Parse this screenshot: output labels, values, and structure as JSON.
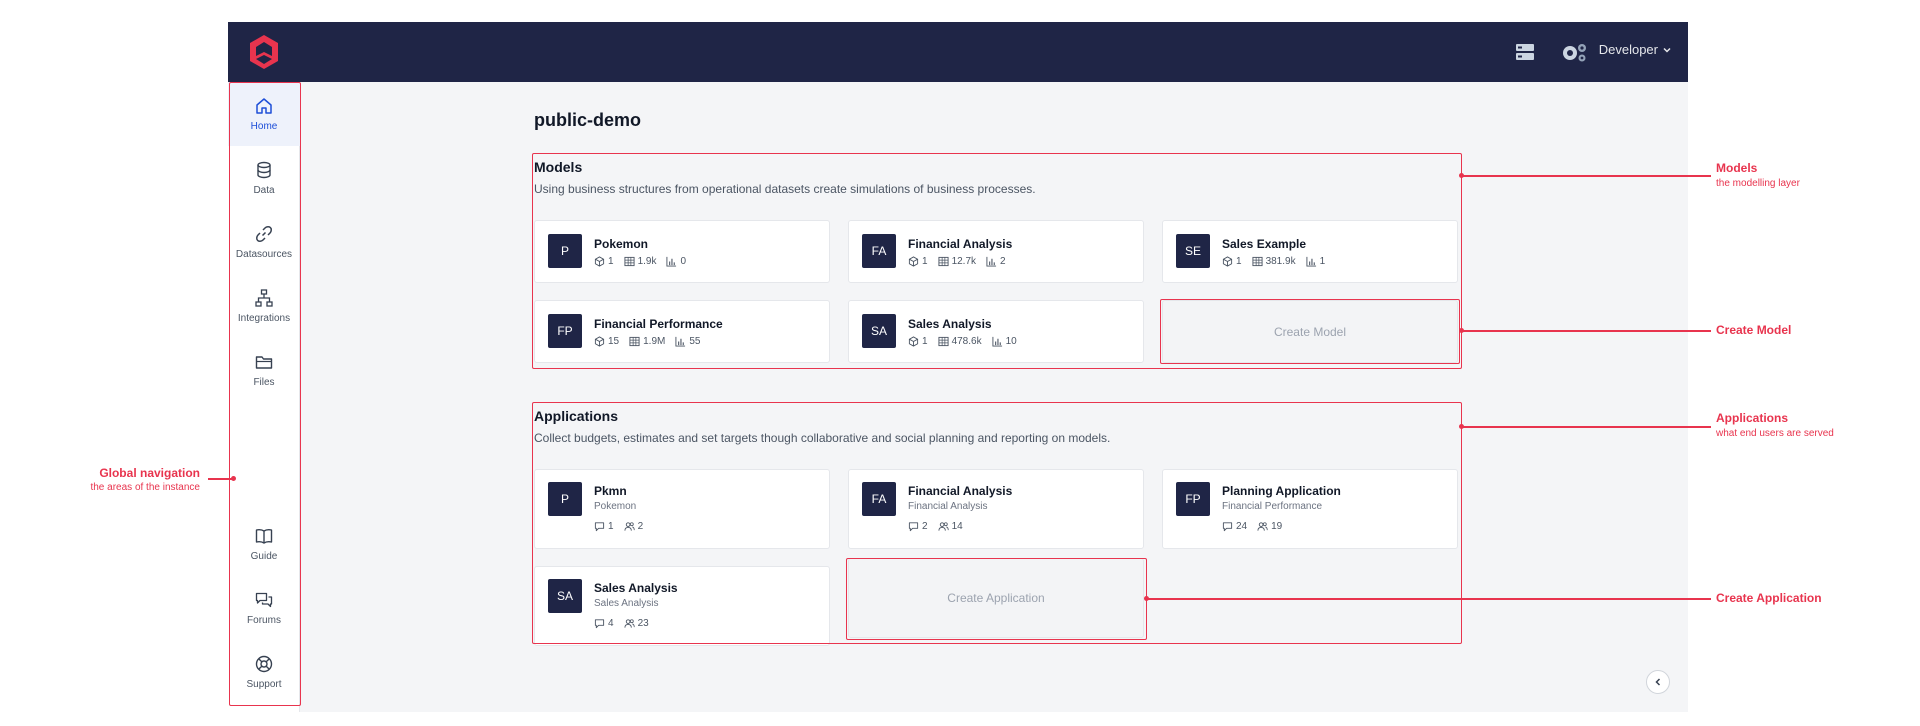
{
  "topbar": {
    "user_label": "Developer"
  },
  "sidebar": {
    "items": [
      {
        "label": "Home",
        "icon": "home-icon"
      },
      {
        "label": "Data",
        "icon": "database-icon"
      },
      {
        "label": "Datasources",
        "icon": "link-icon"
      },
      {
        "label": "Integrations",
        "icon": "network-icon"
      },
      {
        "label": "Files",
        "icon": "folder-icon"
      },
      {
        "label": "Guide",
        "icon": "book-icon"
      },
      {
        "label": "Forums",
        "icon": "chat-icon"
      },
      {
        "label": "Support",
        "icon": "lifebuoy-icon"
      }
    ]
  },
  "main": {
    "title": "public-demo",
    "models": {
      "title": "Models",
      "description": "Using business structures from operational datasets create simulations of business processes.",
      "cards": [
        {
          "initials": "P",
          "name": "Pokemon",
          "cubes": "1",
          "rows": "1.9k",
          "charts": "0"
        },
        {
          "initials": "FA",
          "name": "Financial Analysis",
          "cubes": "1",
          "rows": "12.7k",
          "charts": "2"
        },
        {
          "initials": "SE",
          "name": "Sales Example",
          "cubes": "1",
          "rows": "381.9k",
          "charts": "1"
        },
        {
          "initials": "FP",
          "name": "Financial Performance",
          "cubes": "15",
          "rows": "1.9M",
          "charts": "55"
        },
        {
          "initials": "SA",
          "name": "Sales Analysis",
          "cubes": "1",
          "rows": "478.6k",
          "charts": "10"
        }
      ],
      "create_label": "Create Model"
    },
    "applications": {
      "title": "Applications",
      "description": "Collect budgets, estimates and set targets though collaborative and social planning and reporting on models.",
      "cards": [
        {
          "initials": "P",
          "name": "Pkmn",
          "model": "Pokemon",
          "comments": "1",
          "users": "2"
        },
        {
          "initials": "FA",
          "name": "Financial Analysis",
          "model": "Financial Analysis",
          "comments": "2",
          "users": "14"
        },
        {
          "initials": "FP",
          "name": "Planning Application",
          "model": "Financial Performance",
          "comments": "24",
          "users": "19"
        },
        {
          "initials": "SA",
          "name": "Sales Analysis",
          "model": "Sales Analysis",
          "comments": "4",
          "users": "23"
        }
      ],
      "create_label": "Create Application"
    }
  },
  "annotations": {
    "global_nav": {
      "title": "Global navigation",
      "subtitle": "the areas of the instance"
    },
    "models": {
      "title": "Models",
      "subtitle": "the modelling layer"
    },
    "create_model": {
      "title": "Create Model"
    },
    "applications": {
      "title": "Applications",
      "subtitle": "what end users are served"
    },
    "create_application": {
      "title": "Create Application"
    }
  },
  "colors": {
    "accent": "#e8344e",
    "navy": "#1f2546",
    "active_nav": "#1d4ed8"
  }
}
